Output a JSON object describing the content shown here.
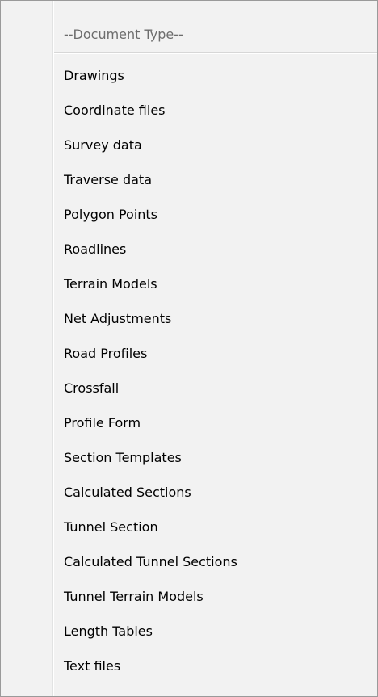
{
  "menu": {
    "header": "--Document Type--",
    "items": [
      "Drawings",
      "Coordinate files",
      "Survey data",
      "Traverse data",
      "Polygon Points",
      "Roadlines",
      "Terrain Models",
      "Net Adjustments",
      "Road Profiles",
      "Crossfall",
      "Profile Form",
      "Section Templates",
      "Calculated Sections",
      "Tunnel Section",
      "Calculated Tunnel Sections",
      "Tunnel Terrain Models",
      "Length Tables",
      "Text files"
    ]
  }
}
